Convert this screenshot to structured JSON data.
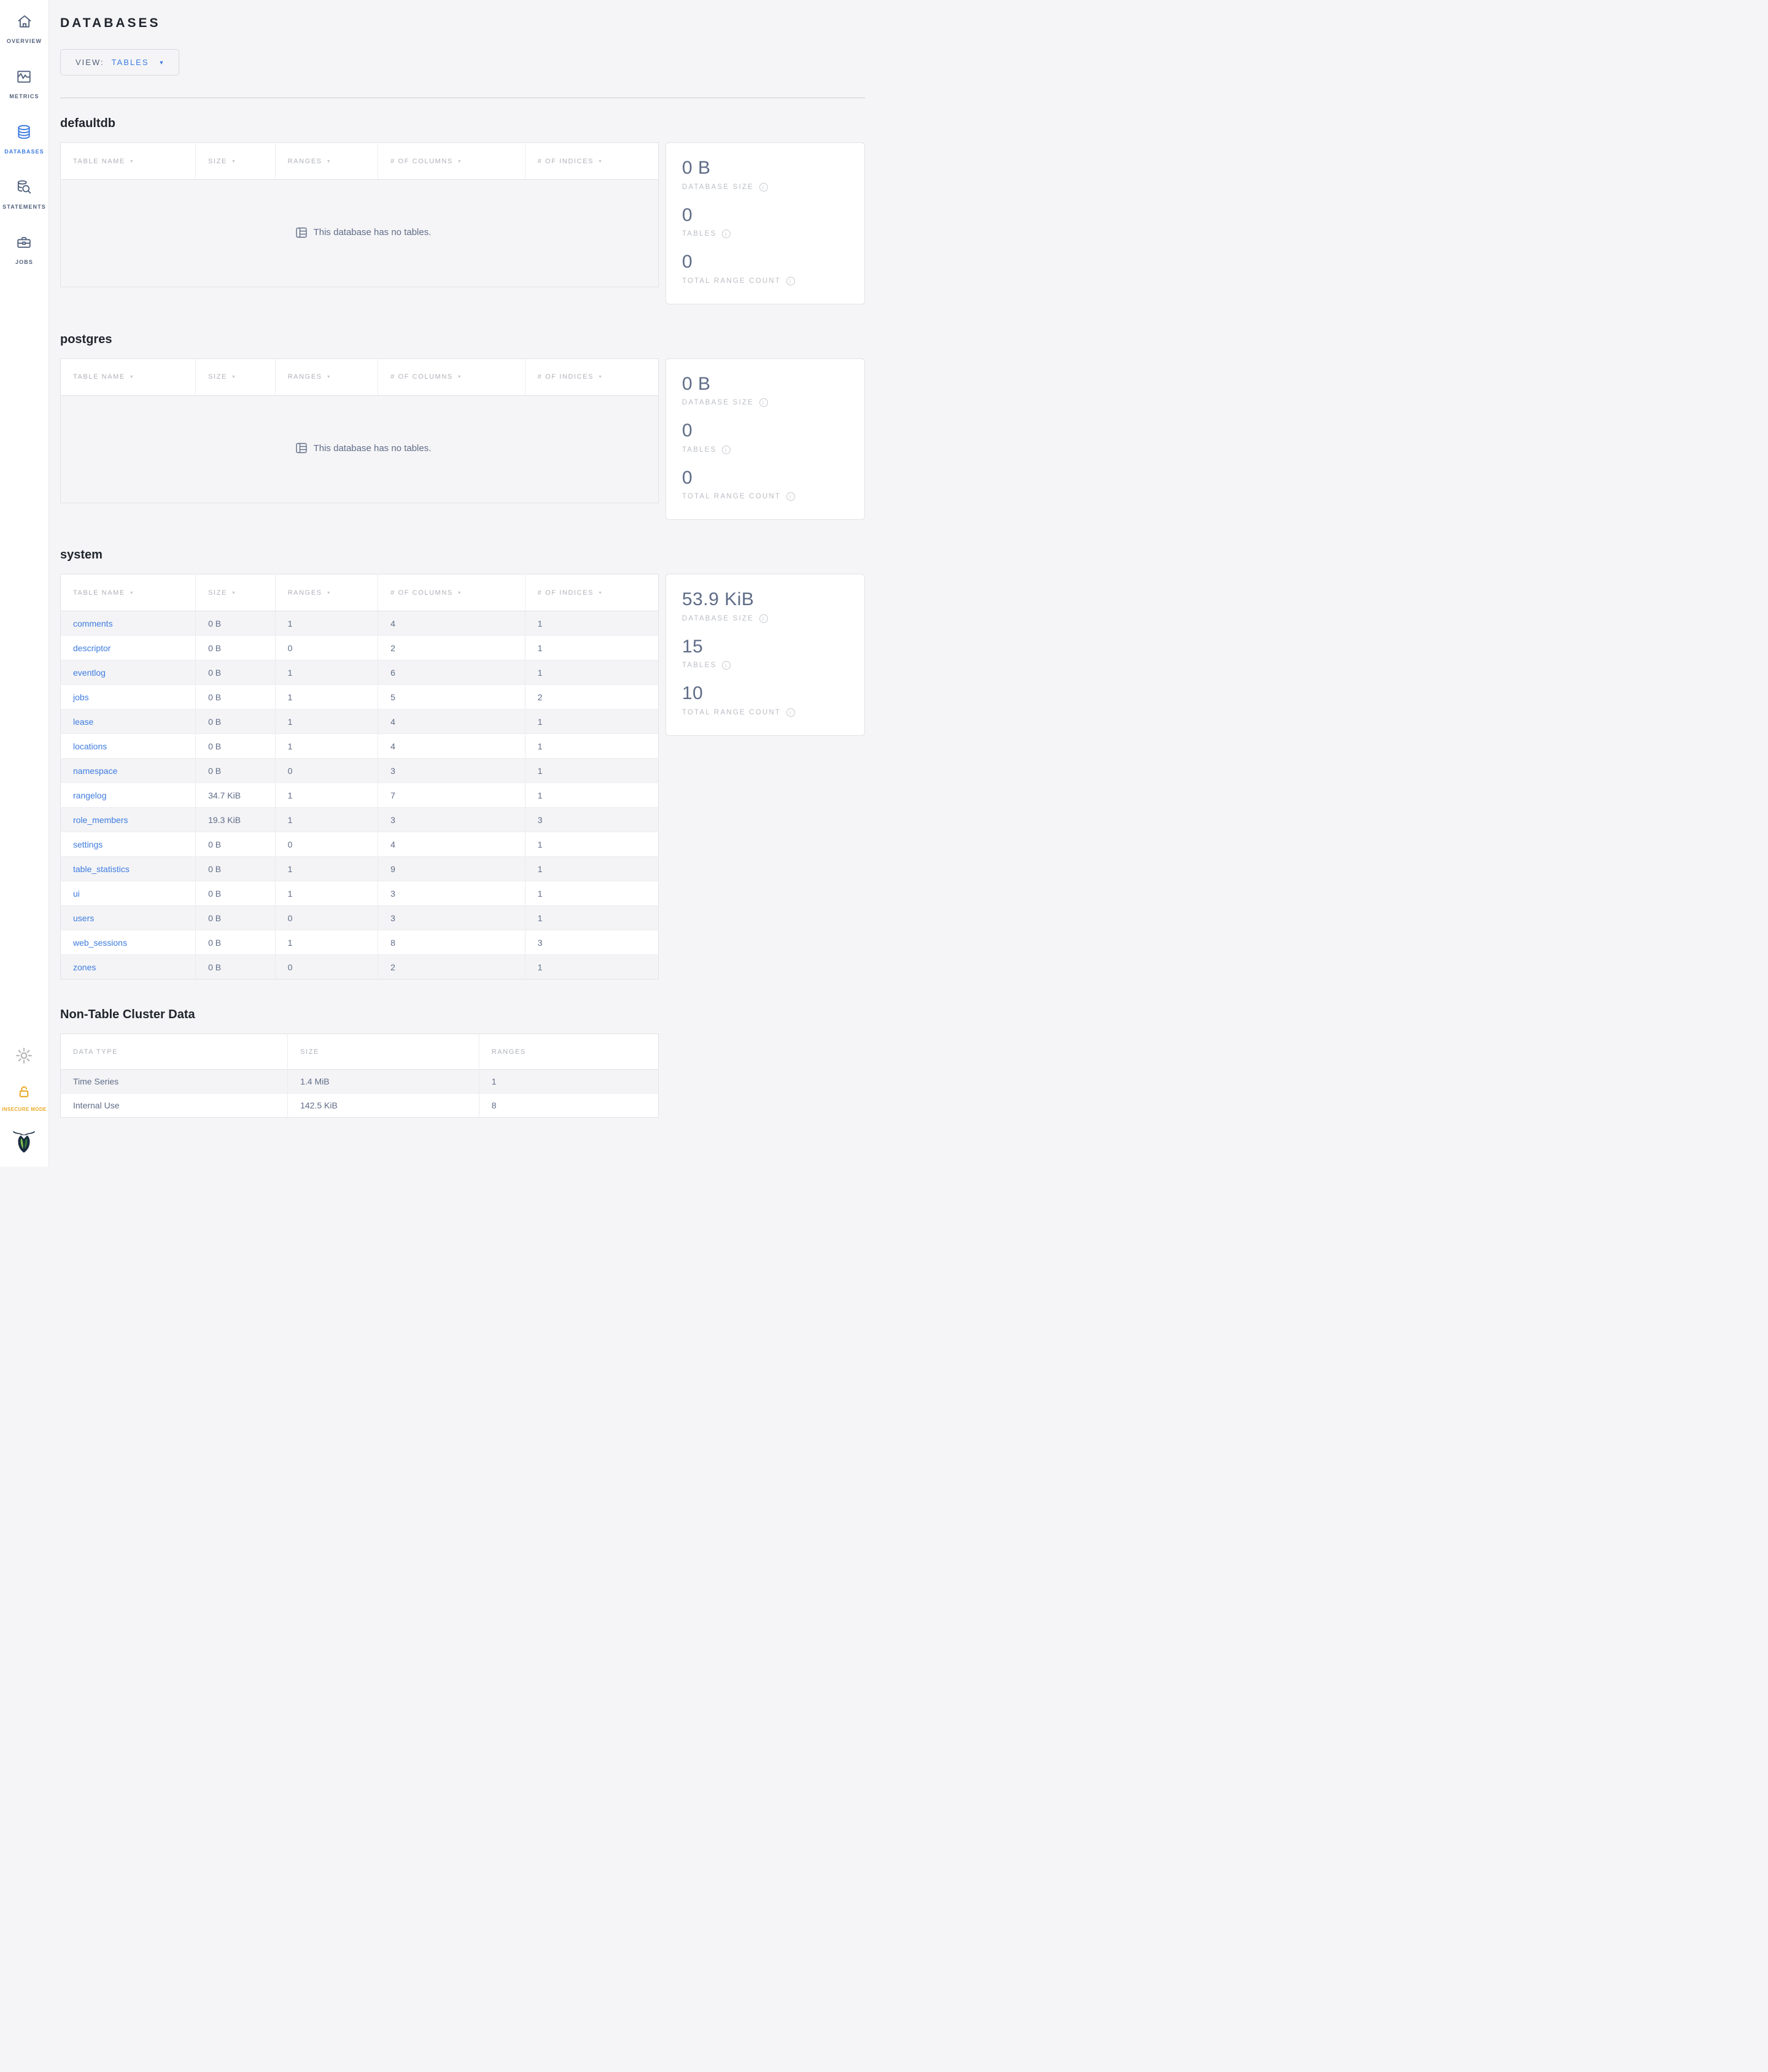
{
  "header": {
    "title": "DATABASES",
    "view_label": "VIEW:",
    "view_value": "TABLES"
  },
  "sidebar": {
    "items": [
      {
        "label": "OVERVIEW",
        "icon": "home-icon",
        "active": false
      },
      {
        "label": "METRICS",
        "icon": "metrics-chart-icon",
        "active": false
      },
      {
        "label": "DATABASES",
        "icon": "database-icon",
        "active": true
      },
      {
        "label": "STATEMENTS",
        "icon": "statements-search-icon",
        "active": false
      },
      {
        "label": "JOBS",
        "icon": "briefcase-icon",
        "active": false
      }
    ],
    "insecure_mode_label": "INSECURE MODE"
  },
  "table_headers": [
    "TABLE NAME",
    "SIZE",
    "RANGES",
    "# OF COLUMNS",
    "# OF INDICES"
  ],
  "empty_message": "This database has no tables.",
  "stats_labels": {
    "size": "DATABASE SIZE",
    "tables": "TABLES",
    "ranges": "TOTAL RANGE COUNT"
  },
  "databases": [
    {
      "name": "defaultdb",
      "stats": {
        "size": "0 B",
        "tables": "0",
        "range_count": "0"
      },
      "tables": []
    },
    {
      "name": "postgres",
      "stats": {
        "size": "0 B",
        "tables": "0",
        "range_count": "0"
      },
      "tables": []
    },
    {
      "name": "system",
      "stats": {
        "size": "53.9 KiB",
        "tables": "15",
        "range_count": "10"
      },
      "tables": [
        [
          "comments",
          "0 B",
          "1",
          "4",
          "1"
        ],
        [
          "descriptor",
          "0 B",
          "0",
          "2",
          "1"
        ],
        [
          "eventlog",
          "0 B",
          "1",
          "6",
          "1"
        ],
        [
          "jobs",
          "0 B",
          "1",
          "5",
          "2"
        ],
        [
          "lease",
          "0 B",
          "1",
          "4",
          "1"
        ],
        [
          "locations",
          "0 B",
          "1",
          "4",
          "1"
        ],
        [
          "namespace",
          "0 B",
          "0",
          "3",
          "1"
        ],
        [
          "rangelog",
          "34.7 KiB",
          "1",
          "7",
          "1"
        ],
        [
          "role_members",
          "19.3 KiB",
          "1",
          "3",
          "3"
        ],
        [
          "settings",
          "0 B",
          "0",
          "4",
          "1"
        ],
        [
          "table_statistics",
          "0 B",
          "1",
          "9",
          "1"
        ],
        [
          "ui",
          "0 B",
          "1",
          "3",
          "1"
        ],
        [
          "users",
          "0 B",
          "0",
          "3",
          "1"
        ],
        [
          "web_sessions",
          "0 B",
          "1",
          "8",
          "3"
        ],
        [
          "zones",
          "0 B",
          "0",
          "2",
          "1"
        ]
      ]
    }
  ],
  "non_table": {
    "title": "Non-Table Cluster Data",
    "headers": [
      "DATA TYPE",
      "SIZE",
      "RANGES"
    ],
    "rows": [
      [
        "Time Series",
        "1.4 MiB",
        "1"
      ],
      [
        "Internal Use",
        "142.5 KiB",
        "8"
      ]
    ]
  },
  "colors": {
    "link_blue": "#3e7ce0",
    "slate": "#5f6c87",
    "insecure_amber": "#eaaa28",
    "page_background": "#f5f5f7"
  }
}
